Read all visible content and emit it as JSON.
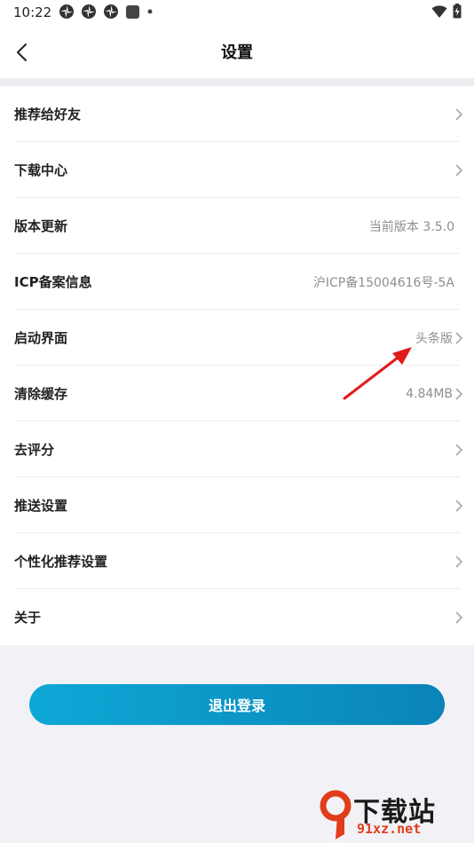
{
  "status_bar": {
    "time": "10:22",
    "icons": [
      "pinwheel-icon",
      "pinwheel-icon",
      "pinwheel-icon",
      "app-square-icon",
      "dot-icon"
    ],
    "right_icons": [
      "wifi-icon",
      "battery-icon"
    ]
  },
  "header": {
    "title": "设置",
    "back_icon": "chevron-left-icon"
  },
  "settings": [
    {
      "label": "推荐给好友",
      "value": "",
      "chevron": true
    },
    {
      "label": "下载中心",
      "value": "",
      "chevron": true
    },
    {
      "label": "版本更新",
      "value": "当前版本 3.5.0",
      "chevron": false
    },
    {
      "label": "ICP备案信息",
      "value": "沪ICP备15004616号-5A",
      "chevron": false
    },
    {
      "label": "启动界面",
      "value": "头条版",
      "chevron": true
    },
    {
      "label": "清除缓存",
      "value": "4.84MB",
      "chevron": true
    },
    {
      "label": "去评分",
      "value": "",
      "chevron": true
    },
    {
      "label": "推送设置",
      "value": "",
      "chevron": true
    },
    {
      "label": "个性化推荐设置",
      "value": "",
      "chevron": true
    },
    {
      "label": "关于",
      "value": "",
      "chevron": true
    }
  ],
  "logout_label": "退出登录",
  "watermark": {
    "logo_text": "下载站",
    "url": "91xz.net"
  },
  "colors": {
    "accent_start": "#0ea8d6",
    "accent_end": "#0a84b8",
    "annotation": "#e01b1b",
    "background": "#f2f2f6"
  }
}
